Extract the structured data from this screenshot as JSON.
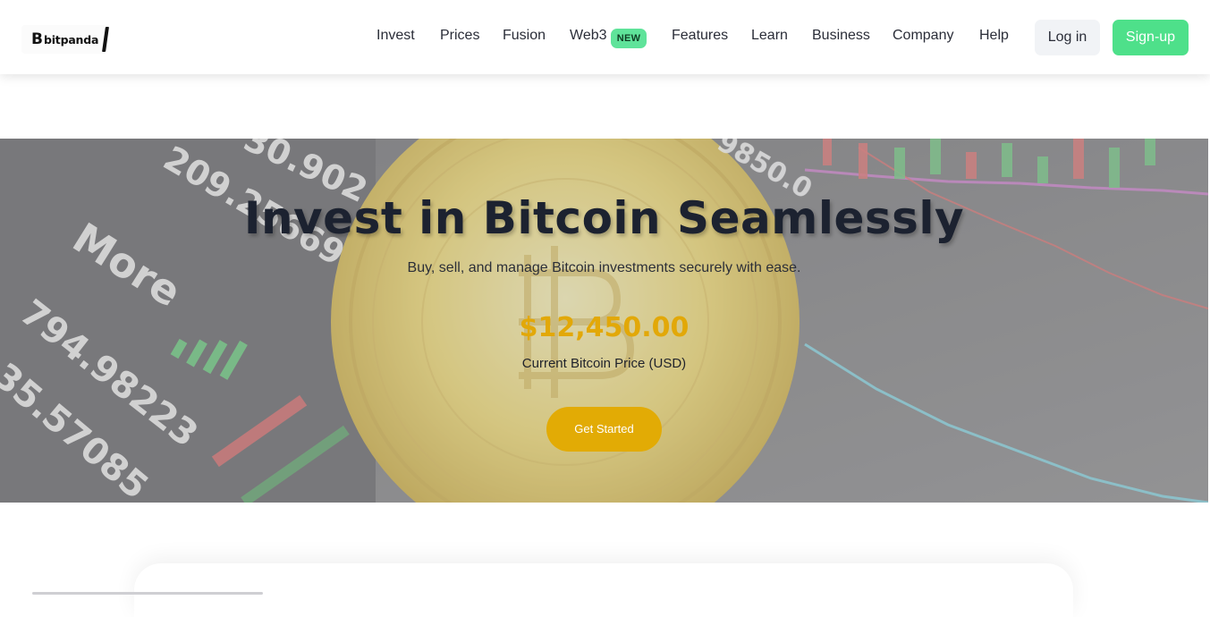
{
  "brand": {
    "logo_text": "bitpanda",
    "logo_glyph": "B"
  },
  "nav": {
    "items": [
      {
        "label": "Invest"
      },
      {
        "label": "Prices"
      },
      {
        "label": "Fusion"
      },
      {
        "label": "Web3"
      },
      {
        "label": "Features"
      },
      {
        "label": "Learn"
      },
      {
        "label": "Business"
      },
      {
        "label": "Company"
      },
      {
        "label": "Help"
      }
    ],
    "web3_badge": "NEW"
  },
  "auth": {
    "login_label": "Log in",
    "signup_label": "Sign-up"
  },
  "hero": {
    "title": "Invest in Bitcoin Seamlessly",
    "subtitle": "Buy, sell, and manage Bitcoin investments securely with ease.",
    "price": "$12,450.00",
    "price_label": "Current Bitcoin Price (USD)",
    "cta_label": "Get Started",
    "background_numbers": [
      "209.25669",
      "More",
      "794.98223",
      "35.57085",
      "30.902",
      "9850.0"
    ]
  },
  "colors": {
    "accent_gold": "#e2ab05",
    "signup_green": "#4ee08a",
    "badge_green": "#5fe39a",
    "title_dark": "#1c2230"
  }
}
